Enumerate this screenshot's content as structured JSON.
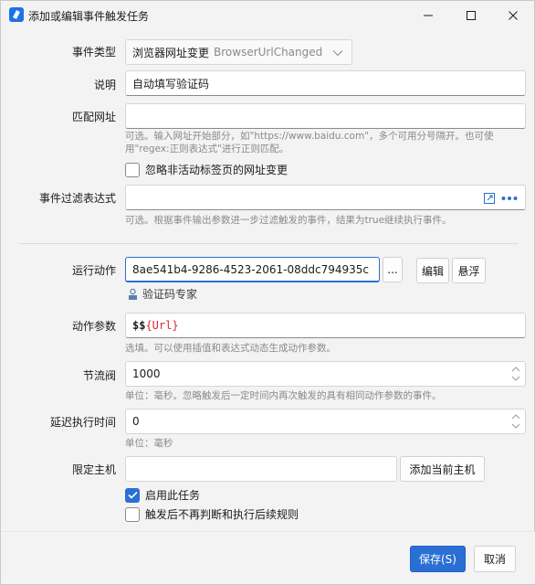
{
  "window": {
    "title": "添加或编辑事件触发任务",
    "minimize_icon": "minimize-icon",
    "maximize_icon": "maximize-icon",
    "close_icon": "close-icon"
  },
  "form": {
    "event_type": {
      "label": "事件类型",
      "value_cn": "浏览器网址变更",
      "value_en": "BrowserUrlChanged"
    },
    "description": {
      "label": "说明",
      "value": "自动填写验证码"
    },
    "match_url": {
      "label": "匹配网址",
      "value": "",
      "hint_line1": "可选。输入网址开始部分，如\"https://www.baidu.com\"，多个可用分号隔开。也可使",
      "hint_line2": "用\"regex:正则表达式\"进行正则匹配。"
    },
    "ignore_inactive": {
      "label": "忽略非活动标签页的网址变更",
      "checked": false
    },
    "filter_expr": {
      "label": "事件过滤表达式",
      "value": "",
      "hint": "可选。根据事件输出参数进一步过滤触发的事件，结果为true继续执行事件。"
    },
    "run_action": {
      "label": "运行动作",
      "value": "8ae541b4-9286-4523-2061-08ddc794935c",
      "browse_label": "...",
      "edit_label": "编辑",
      "float_label": "悬浮",
      "action_name": "验证码专家"
    },
    "action_params": {
      "label": "动作参数",
      "value_prefix": "$$",
      "value_var": "{Url}",
      "hint": "选填。可以使用插值和表达式动态生成动作参数。"
    },
    "throttle": {
      "label": "节流阀",
      "value": "1000",
      "hint": "单位：毫秒。忽略触发后一定时间内再次触发的具有相同动作参数的事件。"
    },
    "delay": {
      "label": "延迟执行时间",
      "value": "0",
      "hint": "单位：毫秒"
    },
    "host": {
      "label": "限定主机",
      "value": "",
      "add_label": "添加当前主机"
    },
    "enable_task": {
      "label": "启用此任务",
      "checked": true
    },
    "stop_after": {
      "label": "触发后不再判断和执行后续规则",
      "checked": false
    }
  },
  "footer": {
    "save_label": "保存(S)",
    "cancel_label": "取消"
  },
  "colors": {
    "accent": "#2a6fd4",
    "hint": "#8a8a8a",
    "var_red": "#d12b2b"
  }
}
